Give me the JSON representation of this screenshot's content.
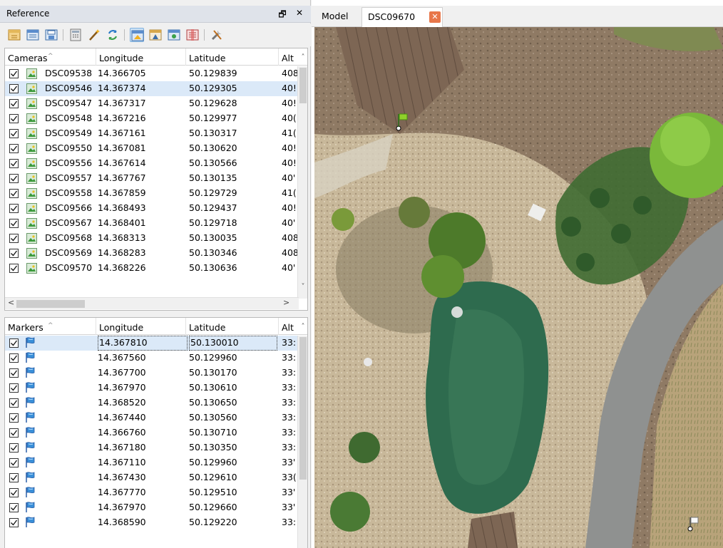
{
  "reference_panel": {
    "title": "Reference",
    "float_glyph": "🗗",
    "close_glyph": "✕"
  },
  "toolbar": {
    "icons": [
      "import-icon",
      "export-icon",
      "save-icon",
      "calculator-icon",
      "wand-icon",
      "update-icon",
      "view-estimated-icon",
      "view-errors-icon",
      "view-source-icon",
      "view-variance-icon",
      "settings-icon"
    ]
  },
  "cameras_table": {
    "headers": [
      "Cameras",
      "Longitude",
      "Latitude",
      "Alt"
    ],
    "rows": [
      {
        "label": "DSC09538",
        "longitude": "14.366705",
        "latitude": "50.129839",
        "alt": "408"
      },
      {
        "label": "DSC09546",
        "longitude": "14.367374",
        "latitude": "50.129305",
        "alt": "40!"
      },
      {
        "label": "DSC09547",
        "longitude": "14.367317",
        "latitude": "50.129628",
        "alt": "40!"
      },
      {
        "label": "DSC09548",
        "longitude": "14.367216",
        "latitude": "50.129977",
        "alt": "40("
      },
      {
        "label": "DSC09549",
        "longitude": "14.367161",
        "latitude": "50.130317",
        "alt": "41("
      },
      {
        "label": "DSC09550",
        "longitude": "14.367081",
        "latitude": "50.130620",
        "alt": "40!"
      },
      {
        "label": "DSC09556",
        "longitude": "14.367614",
        "latitude": "50.130566",
        "alt": "40!"
      },
      {
        "label": "DSC09557",
        "longitude": "14.367767",
        "latitude": "50.130135",
        "alt": "40'"
      },
      {
        "label": "DSC09558",
        "longitude": "14.367859",
        "latitude": "50.129729",
        "alt": "41("
      },
      {
        "label": "DSC09566",
        "longitude": "14.368493",
        "latitude": "50.129437",
        "alt": "40!"
      },
      {
        "label": "DSC09567",
        "longitude": "14.368401",
        "latitude": "50.129718",
        "alt": "40'"
      },
      {
        "label": "DSC09568",
        "longitude": "14.368313",
        "latitude": "50.130035",
        "alt": "408"
      },
      {
        "label": "DSC09569",
        "longitude": "14.368283",
        "latitude": "50.130346",
        "alt": "408"
      },
      {
        "label": "DSC09570",
        "longitude": "14.368226",
        "latitude": "50.130636",
        "alt": "40'"
      }
    ],
    "selected_index": 1
  },
  "markers_table": {
    "headers": [
      "Markers",
      "Longitude",
      "Latitude",
      "Alt"
    ],
    "rows": [
      {
        "longitude": "14.367810",
        "latitude": "50.130010",
        "alt": "33:"
      },
      {
        "longitude": "14.367560",
        "latitude": "50.129960",
        "alt": "33:"
      },
      {
        "longitude": "14.367700",
        "latitude": "50.130170",
        "alt": "33:"
      },
      {
        "longitude": "14.367970",
        "latitude": "50.130610",
        "alt": "33:"
      },
      {
        "longitude": "14.368520",
        "latitude": "50.130650",
        "alt": "33:"
      },
      {
        "longitude": "14.367440",
        "latitude": "50.130560",
        "alt": "33:"
      },
      {
        "longitude": "14.366760",
        "latitude": "50.130710",
        "alt": "33:"
      },
      {
        "longitude": "14.367180",
        "latitude": "50.130350",
        "alt": "33:"
      },
      {
        "longitude": "14.367110",
        "latitude": "50.129960",
        "alt": "33'"
      },
      {
        "longitude": "14.367430",
        "latitude": "50.129610",
        "alt": "33("
      },
      {
        "longitude": "14.367770",
        "latitude": "50.129510",
        "alt": "33'"
      },
      {
        "longitude": "14.367970",
        "latitude": "50.129660",
        "alt": "33'"
      },
      {
        "longitude": "14.368590",
        "latitude": "50.129220",
        "alt": "33:"
      }
    ],
    "selected_index": 0
  },
  "viewer": {
    "tabs": [
      {
        "label": "Model"
      },
      {
        "label": "DSC09670"
      }
    ],
    "active_tab": 1,
    "close_glyph": "✕"
  },
  "colors": {
    "selection": "#dbe9f8",
    "tab_close": "#e8774a",
    "marker_flag": "#3a8fd8"
  }
}
